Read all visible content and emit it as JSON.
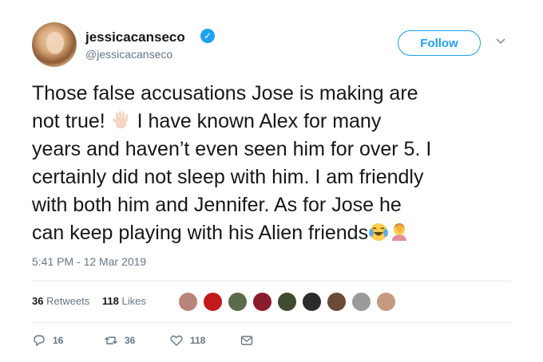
{
  "user": {
    "display_name": "jessicacanseco",
    "handle": "@jessicacanseco",
    "verified_badge": "verified-badge-icon"
  },
  "follow_button": {
    "label": "Follow"
  },
  "tweet": {
    "line1": "Those false accusations Jose is making are",
    "line2a": "not true! ",
    "line2b": " I have  known Alex for many",
    "line3": "years and haven’t even seen him for over 5. I",
    "line4": "certainly did not sleep with him. I am friendly",
    "line5": "with both him and Jennifer. As for Jose he",
    "line6": "can keep playing with his Alien friends",
    "emojis": [
      "raised-hand-icon",
      "laughing-tears-icon",
      "facepalm-icon"
    ]
  },
  "timestamp": "5:41 PM - 12 Mar 2019",
  "stats": {
    "retweets_count": "36",
    "retweets_label": "Retweets",
    "likes_count": "118",
    "likes_label": "Likes"
  },
  "actions": {
    "reply_count": "16",
    "retweet_count": "36",
    "like_count": "118"
  },
  "colors": {
    "accent": "#1da1f2",
    "secondary_text": "#657786",
    "divider": "#e6ecf0"
  }
}
